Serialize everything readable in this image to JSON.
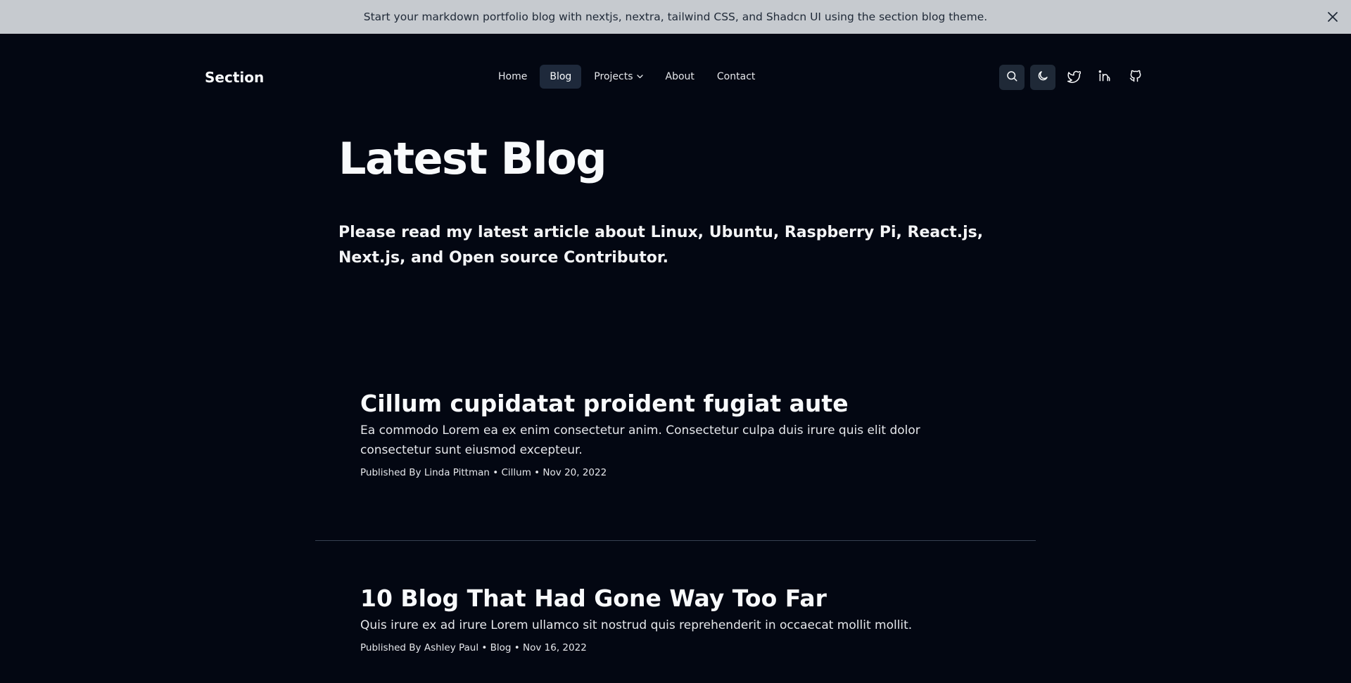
{
  "banner": {
    "text": "Start your markdown portfolio blog with nextjs, nextra, tailwind CSS, and Shadcn UI using  the section blog theme.",
    "close_icon": "close-icon"
  },
  "nav": {
    "brand": "Section",
    "links": [
      {
        "label": "Home"
      },
      {
        "label": "Blog",
        "active": true
      },
      {
        "label": "Projects",
        "has_dropdown": true
      },
      {
        "label": "About"
      },
      {
        "label": "Contact"
      }
    ],
    "icons": [
      "search-icon",
      "moon-icon",
      "twitter-icon",
      "linkedin-icon",
      "github-icon"
    ]
  },
  "hero": {
    "title": "Latest Blog",
    "subtitle": "Please read my latest article about Linux, Ubuntu, Raspberry Pi, React.js, Next.js, and Open source Contributor."
  },
  "posts": [
    {
      "title": "Cillum cupidatat proident fugiat aute",
      "excerpt": "Ea commodo Lorem ea ex enim consectetur anim. Consectetur culpa duis irure quis elit dolor consectetur sunt eiusmod excepteur.",
      "meta": "Published By Linda Pittman • Cillum • Nov 20, 2022"
    },
    {
      "title": "10 Blog That Had Gone Way Too Far",
      "excerpt": "Quis irure ex ad irure Lorem ullamco sit nostrud quis reprehenderit in occaecat mollit mollit.",
      "meta": "Published By Ashley Paul • Blog • Nov 16, 2022"
    }
  ],
  "colors": {
    "background": "#030712",
    "banner": "#c6cacf",
    "active_nav": "#1e293b"
  }
}
